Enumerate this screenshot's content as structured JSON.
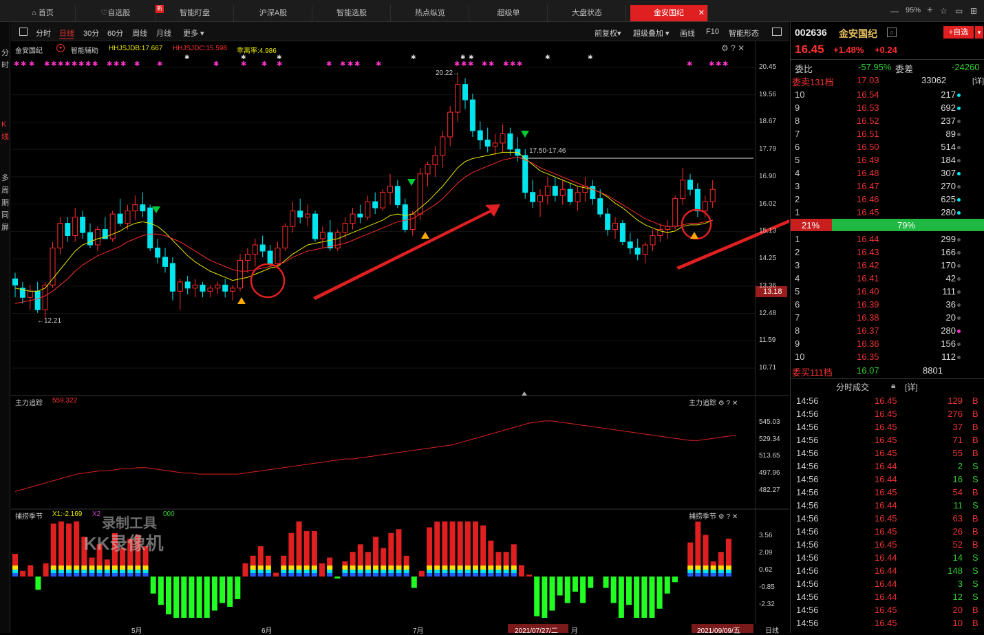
{
  "tabs": [
    {
      "label": "首页"
    },
    {
      "label": "自选股"
    },
    {
      "label": "智能盯盘"
    },
    {
      "label": "沪深A股"
    },
    {
      "label": "智能选股"
    },
    {
      "label": "热点纵览"
    },
    {
      "label": "超级单"
    },
    {
      "label": "大盘状态"
    },
    {
      "label": "金安国纪"
    }
  ],
  "zoom": "95%",
  "vtabs": [
    "分时",
    "K线",
    "多周期同屏"
  ],
  "periods": [
    "分时",
    "日线",
    "30分",
    "60分",
    "周线",
    "月线",
    "更多"
  ],
  "tools": [
    "前复权",
    "超级叠加",
    "画线",
    "F10",
    "智能形态"
  ],
  "legend": {
    "name": "金安国纪",
    "assist": "智能辅助",
    "l1": "HHJSJDB:17.667",
    "l2": "HHJSJDC:15.598",
    "l3": "乖离率:4.986"
  },
  "colors": {
    "up": "#ff2d2d",
    "down": "#00e5ee",
    "ma1": "#e8e800",
    "ma2": "#ff2d2d",
    "vol": "#00ff22"
  },
  "price_axis": [
    "20.45",
    "19.56",
    "18.67",
    "17.79",
    "16.90",
    "16.02",
    "15.13",
    "14.25",
    "13.36",
    "12.48",
    "11.59",
    "10.71"
  ],
  "current_price_tag": "13.18",
  "annotations": {
    "high": "20.22",
    "low": "12.21",
    "level": "17.50-17.46"
  },
  "ind1": {
    "name": "主力追踪",
    "value": "559.322",
    "axis": [
      "545.03",
      "529.34",
      "513.65",
      "497.96",
      "482.27"
    ]
  },
  "ind2": {
    "name": "捕捞季节",
    "x1": "X1:-2.169",
    "x2": "X2",
    "x3": "000",
    "axis": [
      "3.56",
      "2.09",
      "0.62",
      "-0.85",
      "-2.32"
    ]
  },
  "watermark": {
    "l1": "录制工具",
    "l2": "KK录像机"
  },
  "xaxis": [
    "5月",
    "6月",
    "7月",
    "月"
  ],
  "date_tags": [
    "2021/07/27/二",
    "2021/09/09/五"
  ],
  "period_label": "日线",
  "chart_data": {
    "type": "candlestick",
    "ohlc": [
      [
        13.6,
        13.8,
        13.0,
        13.4
      ],
      [
        13.3,
        13.5,
        12.8,
        13.0
      ],
      [
        13.0,
        13.4,
        12.6,
        13.2
      ],
      [
        13.2,
        13.5,
        12.5,
        12.6
      ],
      [
        12.6,
        13.5,
        12.3,
        13.4
      ],
      [
        13.4,
        14.8,
        13.3,
        14.6
      ],
      [
        14.6,
        15.6,
        14.4,
        15.4
      ],
      [
        15.4,
        15.6,
        14.8,
        15.0
      ],
      [
        15.0,
        15.9,
        14.8,
        15.6
      ],
      [
        15.6,
        15.8,
        14.9,
        15.1
      ],
      [
        15.1,
        15.4,
        14.6,
        14.7
      ],
      [
        14.7,
        15.3,
        14.5,
        15.2
      ],
      [
        15.2,
        15.6,
        14.9,
        14.9
      ],
      [
        14.9,
        15.8,
        14.8,
        15.7
      ],
      [
        15.7,
        16.2,
        15.3,
        15.4
      ],
      [
        15.4,
        16.0,
        15.2,
        15.8
      ],
      [
        15.8,
        16.3,
        15.5,
        16.0
      ],
      [
        16.0,
        16.4,
        15.6,
        15.8
      ],
      [
        15.9,
        16.0,
        14.5,
        14.6
      ],
      [
        14.6,
        14.9,
        14.1,
        14.3
      ],
      [
        14.3,
        14.6,
        13.8,
        14.0
      ],
      [
        14.1,
        14.3,
        12.9,
        13.2
      ],
      [
        13.2,
        13.6,
        12.6,
        13.5
      ],
      [
        13.5,
        13.7,
        13.1,
        13.3
      ],
      [
        13.3,
        13.6,
        13.0,
        13.4
      ],
      [
        13.4,
        13.5,
        13.0,
        13.2
      ],
      [
        13.2,
        13.4,
        13.0,
        13.3
      ],
      [
        13.3,
        13.5,
        13.1,
        13.4
      ],
      [
        13.4,
        13.6,
        13.0,
        13.2
      ],
      [
        13.2,
        13.4,
        12.9,
        13.3
      ],
      [
        13.3,
        14.4,
        13.2,
        14.2
      ],
      [
        14.2,
        14.6,
        13.8,
        14.4
      ],
      [
        14.4,
        14.9,
        14.0,
        14.7
      ],
      [
        14.7,
        15.0,
        14.3,
        14.5
      ],
      [
        14.5,
        14.7,
        14.0,
        14.1
      ],
      [
        14.1,
        14.8,
        14.0,
        14.6
      ],
      [
        14.6,
        15.4,
        14.5,
        15.3
      ],
      [
        15.3,
        16.1,
        15.1,
        15.8
      ],
      [
        15.8,
        16.2,
        15.4,
        15.6
      ],
      [
        15.6,
        16.0,
        15.3,
        15.7
      ],
      [
        15.7,
        15.8,
        14.8,
        14.9
      ],
      [
        14.9,
        15.3,
        14.6,
        15.1
      ],
      [
        15.1,
        15.5,
        14.5,
        14.6
      ],
      [
        14.6,
        15.2,
        14.5,
        15.1
      ],
      [
        15.1,
        15.6,
        14.9,
        15.4
      ],
      [
        15.4,
        15.9,
        15.2,
        15.7
      ],
      [
        15.7,
        16.0,
        15.4,
        15.6
      ],
      [
        15.6,
        16.3,
        15.5,
        16.1
      ],
      [
        16.1,
        16.4,
        15.7,
        15.9
      ],
      [
        15.9,
        16.5,
        15.8,
        16.4
      ],
      [
        16.4,
        17.0,
        16.0,
        16.6
      ],
      [
        16.6,
        16.8,
        15.9,
        16.0
      ],
      [
        16.0,
        16.2,
        15.1,
        15.2
      ],
      [
        15.2,
        15.8,
        15.0,
        15.7
      ],
      [
        15.7,
        17.2,
        15.5,
        17.0
      ],
      [
        17.0,
        17.4,
        16.6,
        17.3
      ],
      [
        17.3,
        17.9,
        16.9,
        17.6
      ],
      [
        17.6,
        18.4,
        17.2,
        18.2
      ],
      [
        18.2,
        19.2,
        17.9,
        19.0
      ],
      [
        19.0,
        20.2,
        18.7,
        19.9
      ],
      [
        19.9,
        20.1,
        19.1,
        19.4
      ],
      [
        19.4,
        19.6,
        18.2,
        18.4
      ],
      [
        18.4,
        18.7,
        17.8,
        18.1
      ],
      [
        18.1,
        18.5,
        17.7,
        17.9
      ],
      [
        17.9,
        18.3,
        17.6,
        18.0
      ],
      [
        18.0,
        18.6,
        17.7,
        18.3
      ],
      [
        18.3,
        18.5,
        17.6,
        17.8
      ],
      [
        17.8,
        18.2,
        17.4,
        17.6
      ],
      [
        17.6,
        17.8,
        16.2,
        16.4
      ],
      [
        16.4,
        16.8,
        15.9,
        16.1
      ],
      [
        16.1,
        16.5,
        15.6,
        16.3
      ],
      [
        16.3,
        16.9,
        16.0,
        16.6
      ],
      [
        16.6,
        16.9,
        16.1,
        16.3
      ],
      [
        16.3,
        16.8,
        16.0,
        16.5
      ],
      [
        16.5,
        16.7,
        16.0,
        16.1
      ],
      [
        16.1,
        16.6,
        15.8,
        16.4
      ],
      [
        16.4,
        16.9,
        16.1,
        16.6
      ],
      [
        16.6,
        16.8,
        16.0,
        16.2
      ],
      [
        16.2,
        16.5,
        15.6,
        15.7
      ],
      [
        15.7,
        15.9,
        15.0,
        15.2
      ],
      [
        15.2,
        15.6,
        14.9,
        15.4
      ],
      [
        15.4,
        15.5,
        14.7,
        14.8
      ],
      [
        14.8,
        15.1,
        14.4,
        14.6
      ],
      [
        14.6,
        14.9,
        14.2,
        14.4
      ],
      [
        14.4,
        14.8,
        14.1,
        14.7
      ],
      [
        14.7,
        15.2,
        14.5,
        15.0
      ],
      [
        15.0,
        15.4,
        14.8,
        15.2
      ],
      [
        15.2,
        15.5,
        14.9,
        15.3
      ],
      [
        15.3,
        16.3,
        15.2,
        16.2
      ],
      [
        16.2,
        17.2,
        16.0,
        16.8
      ],
      [
        16.8,
        17.0,
        16.3,
        16.5
      ],
      [
        16.5,
        16.7,
        15.6,
        15.8
      ],
      [
        15.8,
        16.3,
        15.6,
        16.1
      ],
      [
        16.1,
        16.8,
        15.9,
        16.5
      ]
    ],
    "ma1": [
      13.3,
      13.25,
      13.2,
      13.2,
      13.3,
      13.6,
      13.9,
      14.2,
      14.5,
      14.7,
      14.8,
      14.9,
      14.95,
      15.05,
      15.15,
      15.3,
      15.4,
      15.45,
      15.4,
      15.3,
      15.1,
      14.85,
      14.6,
      14.35,
      14.15,
      14.0,
      13.85,
      13.75,
      13.65,
      13.55,
      13.6,
      13.65,
      13.75,
      13.85,
      13.95,
      14.0,
      14.2,
      14.4,
      14.55,
      14.7,
      14.75,
      14.8,
      14.85,
      14.9,
      15.0,
      15.1,
      15.2,
      15.3,
      15.4,
      15.5,
      15.65,
      15.7,
      15.65,
      15.7,
      15.9,
      16.1,
      16.35,
      16.6,
      16.9,
      17.2,
      17.4,
      17.5,
      17.55,
      17.6,
      17.65,
      17.7,
      17.7,
      17.7,
      17.5,
      17.3,
      17.1,
      17.0,
      16.9,
      16.8,
      16.7,
      16.6,
      16.55,
      16.5,
      16.4,
      16.25,
      16.05,
      15.9,
      15.7,
      15.5,
      15.35,
      15.25,
      15.15,
      15.1,
      15.15,
      15.3,
      15.35,
      15.35,
      15.4,
      15.5
    ],
    "ma2": [
      12.8,
      12.85,
      12.9,
      12.95,
      13.05,
      13.2,
      13.4,
      13.6,
      13.85,
      14.05,
      14.2,
      14.35,
      14.45,
      14.55,
      14.65,
      14.8,
      14.9,
      15.0,
      15.05,
      15.05,
      15.0,
      14.9,
      14.8,
      14.65,
      14.5,
      14.35,
      14.2,
      14.1,
      14.0,
      13.9,
      13.85,
      13.85,
      13.9,
      13.95,
      14.0,
      14.05,
      14.15,
      14.3,
      14.4,
      14.5,
      14.55,
      14.6,
      14.65,
      14.7,
      14.75,
      14.85,
      14.95,
      15.05,
      15.15,
      15.25,
      15.35,
      15.45,
      15.5,
      15.55,
      15.7,
      15.85,
      16.0,
      16.2,
      16.45,
      16.7,
      16.9,
      17.05,
      17.15,
      17.25,
      17.35,
      17.45,
      17.5,
      17.55,
      17.45,
      17.35,
      17.2,
      17.1,
      17.0,
      16.9,
      16.8,
      16.7,
      16.6,
      16.5,
      16.4,
      16.3,
      16.15,
      16.0,
      15.85,
      15.7,
      15.55,
      15.45,
      15.35,
      15.3,
      15.3,
      15.35,
      15.4,
      15.4,
      15.45,
      15.5
    ],
    "main_force": [
      482,
      484,
      486,
      488,
      490,
      492,
      494,
      496,
      498,
      499,
      500,
      501,
      501,
      502,
      503,
      503,
      504,
      504,
      503,
      502,
      501,
      500,
      499,
      499,
      498,
      498,
      498,
      498,
      498,
      498,
      499,
      500,
      501,
      502,
      503,
      504,
      505,
      506,
      507,
      508,
      509,
      510,
      511,
      512,
      512,
      513,
      514,
      515,
      516,
      517,
      518,
      519,
      520,
      521,
      522,
      523,
      524,
      525,
      527,
      529,
      531,
      533,
      535,
      537,
      539,
      541,
      543,
      545,
      546,
      547,
      547,
      546,
      545,
      544,
      543,
      542,
      541,
      540,
      539,
      538,
      537,
      536,
      535,
      534,
      533,
      532,
      531,
      530,
      529,
      529,
      530,
      531,
      532,
      533,
      534
    ]
  },
  "quote": {
    "code": "002636",
    "name": "金安国纪",
    "price": "16.45",
    "chg_pct": "+1.48%",
    "chg": "+0.24",
    "add_btn": "+自选",
    "wb_label": "委比",
    "wb": "-57.95%",
    "wc_label": "委差",
    "wc": "-24260",
    "sell_hdr": {
      "l": "委卖131档",
      "p": "17.03",
      "v": "33062",
      "d": "[详]"
    },
    "sells": [
      [
        "10",
        "16.54",
        "217",
        "c"
      ],
      [
        "9",
        "16.53",
        "692",
        "c"
      ],
      [
        "8",
        "16.52",
        "237",
        "g"
      ],
      [
        "7",
        "16.51",
        "89",
        "g"
      ],
      [
        "6",
        "16.50",
        "514",
        "g"
      ],
      [
        "5",
        "16.49",
        "184",
        "g"
      ],
      [
        "4",
        "16.48",
        "307",
        "c"
      ],
      [
        "3",
        "16.47",
        "270",
        "g"
      ],
      [
        "2",
        "16.46",
        "625",
        "c"
      ],
      [
        "1",
        "16.45",
        "280",
        "c"
      ]
    ],
    "bar": {
      "buy": "21%",
      "sell": "79%",
      "buy_pct": 21
    },
    "buys": [
      [
        "1",
        "16.44",
        "299",
        "g"
      ],
      [
        "2",
        "16.43",
        "166",
        "g"
      ],
      [
        "3",
        "16.42",
        "170",
        "g"
      ],
      [
        "4",
        "16.41",
        "42",
        "g"
      ],
      [
        "5",
        "16.40",
        "111",
        "g"
      ],
      [
        "6",
        "16.39",
        "36",
        "g"
      ],
      [
        "7",
        "16.38",
        "20",
        "g"
      ],
      [
        "8",
        "16.37",
        "280",
        "m"
      ],
      [
        "9",
        "16.36",
        "156",
        "g"
      ],
      [
        "10",
        "16.35",
        "112",
        "g"
      ]
    ],
    "buy_hdr": {
      "l": "委买111档",
      "p": "16.07",
      "v": "8801"
    },
    "ticks_hdr": "分时成交",
    "ticks_detail": "[详]",
    "ticks": [
      [
        "14:56",
        "16.45",
        "129",
        "B"
      ],
      [
        "14:56",
        "16.45",
        "276",
        "B"
      ],
      [
        "14:56",
        "16.45",
        "37",
        "B"
      ],
      [
        "14:56",
        "16.45",
        "71",
        "B"
      ],
      [
        "14:56",
        "16.45",
        "55",
        "B"
      ],
      [
        "14:56",
        "16.44",
        "2",
        "S"
      ],
      [
        "14:56",
        "16.44",
        "16",
        "S"
      ],
      [
        "14:56",
        "16.45",
        "54",
        "B"
      ],
      [
        "14:56",
        "16.44",
        "11",
        "S"
      ],
      [
        "14:56",
        "16.45",
        "63",
        "B"
      ],
      [
        "14:56",
        "16.45",
        "26",
        "B"
      ],
      [
        "14:56",
        "16.45",
        "52",
        "B"
      ],
      [
        "14:56",
        "16.44",
        "14",
        "S"
      ],
      [
        "14:56",
        "16.44",
        "148",
        "S"
      ],
      [
        "14:56",
        "16.44",
        "3",
        "S"
      ],
      [
        "14:56",
        "16.44",
        "12",
        "S"
      ],
      [
        "14:56",
        "16.45",
        "20",
        "B"
      ],
      [
        "14:56",
        "16.45",
        "10",
        "B"
      ]
    ]
  }
}
